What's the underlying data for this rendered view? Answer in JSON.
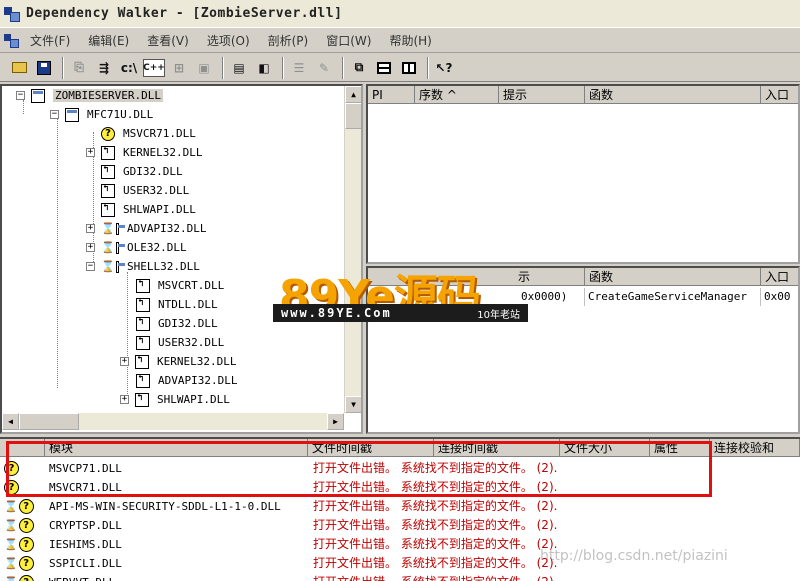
{
  "window": {
    "title": "Dependency Walker - [ZombieServer.dll]"
  },
  "menu": [
    {
      "label": "文件(F)"
    },
    {
      "label": "编辑(E)"
    },
    {
      "label": "查看(V)"
    },
    {
      "label": "选项(O)"
    },
    {
      "label": "剖析(P)"
    },
    {
      "label": "窗口(W)"
    },
    {
      "label": "帮助(H)"
    }
  ],
  "toolbar": {
    "c_label": "c:\\",
    "cpp_label": "C++"
  },
  "tree": {
    "items": [
      {
        "label": "ZOMBIESERVER.DLL",
        "icon": "module-icon"
      },
      {
        "label": "MFC71U.DLL",
        "icon": "module-icon"
      },
      {
        "label": "MSVCR71.DLL",
        "icon": "missing-icon"
      },
      {
        "label": "KERNEL32.DLL",
        "icon": "system-module-icon"
      },
      {
        "label": "GDI32.DLL",
        "icon": "system-module-icon"
      },
      {
        "label": "USER32.DLL",
        "icon": "system-module-icon"
      },
      {
        "label": "SHLWAPI.DLL",
        "icon": "system-module-icon"
      },
      {
        "label": "ADVAPI32.DLL",
        "icon": "delay-load-icon"
      },
      {
        "label": "OLE32.DLL",
        "icon": "delay-load-icon"
      },
      {
        "label": "SHELL32.DLL",
        "icon": "delay-load-icon"
      },
      {
        "label": "MSVCRT.DLL",
        "icon": "system-module-icon"
      },
      {
        "label": "NTDLL.DLL",
        "icon": "system-module-icon"
      },
      {
        "label": "GDI32.DLL",
        "icon": "system-module-icon"
      },
      {
        "label": "USER32.DLL",
        "icon": "system-module-icon"
      },
      {
        "label": "KERNEL32.DLL",
        "icon": "system-module-icon"
      },
      {
        "label": "ADVAPI32.DLL",
        "icon": "system-module-icon"
      },
      {
        "label": "SHLWAPI.DLL",
        "icon": "system-module-icon"
      }
    ]
  },
  "imports": {
    "headers": [
      "PI",
      "序数 ^",
      "提示",
      "函数",
      "入口"
    ]
  },
  "exports": {
    "headers": [
      "示",
      "函数",
      "入口"
    ],
    "rows": [
      {
        "hint": "0x0000)",
        "function": "CreateGameServiceManager",
        "entry": "0x00"
      }
    ]
  },
  "watermark": {
    "brand": "89Ye源码",
    "url": "www.89YE.Com",
    "tag": "10年老站"
  },
  "modules": {
    "headers": [
      "模块",
      "文件时间戳",
      "连接时间戳",
      "文件大小",
      "属性",
      "连接校验和"
    ],
    "error_text": "打开文件出错。 系统找不到指定的文件。 (2).",
    "rows": [
      {
        "name": "MSVCP71.DLL",
        "status": "missing"
      },
      {
        "name": "MSVCR71.DLL",
        "status": "missing"
      },
      {
        "name": "API-MS-WIN-SECURITY-SDDL-L1-1-0.DLL",
        "status": "delay-missing"
      },
      {
        "name": "CRYPTSP.DLL",
        "status": "delay-missing"
      },
      {
        "name": "IESHIMS.DLL",
        "status": "delay-missing"
      },
      {
        "name": "SSPICLI.DLL",
        "status": "delay-missing"
      },
      {
        "name": "WERVVT.DLL",
        "status": "delay-missing"
      }
    ]
  },
  "credit": "http://blog.csdn.net/piazini",
  "colors": {
    "error": "#c00000",
    "highlight_box": "#e01010",
    "watermark": "#f5a300"
  }
}
